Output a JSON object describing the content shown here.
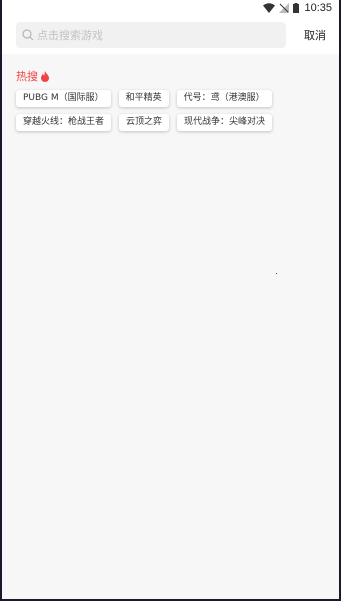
{
  "status_bar": {
    "time": "10:35"
  },
  "search": {
    "placeholder": "点击搜索游戏",
    "cancel_label": "取消"
  },
  "hot": {
    "title": "热搜",
    "row1": [
      "PUBG M（国际服）",
      "和平精英",
      "代号：鸢（港澳服）"
    ],
    "row2": [
      "穿越火线：枪战王者",
      "云顶之弈",
      "现代战争：尖峰对决"
    ]
  },
  "colors": {
    "accent": "#f04444",
    "background": "#f7f7f7"
  }
}
